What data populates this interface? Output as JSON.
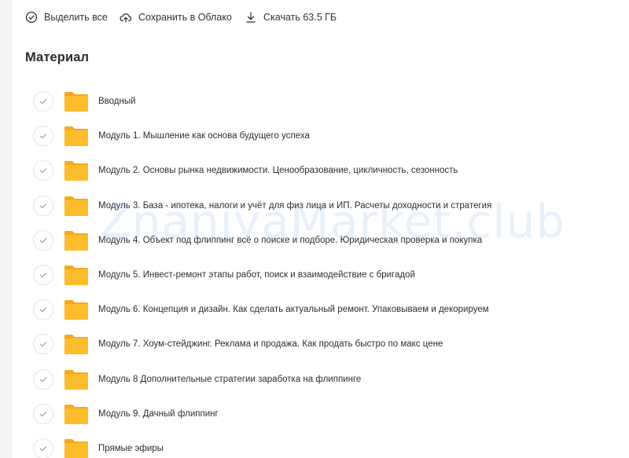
{
  "toolbar": {
    "select_all_label": "Выделить все",
    "save_cloud_label": "Сохранить в Облако",
    "download_label": "Скачать 63.5 ГБ"
  },
  "section": {
    "title": "Материал"
  },
  "items": [
    {
      "label": "Вводный"
    },
    {
      "label": "Модуль 1. Мышление как основа будущего успеха"
    },
    {
      "label": "Модуль 2. Основы рынка недвижимости. Ценообразование, цикличность, сезонность"
    },
    {
      "label": "Модуль 3. База - ипотека, налоги и учёт для физ лица и ИП. Расчеты доходности и стратегия"
    },
    {
      "label": "Модуль 4. Объект под флиппинг всё о поиске и подборе. Юридическая проверка и покупка"
    },
    {
      "label": "Модуль 5. Инвест-ремонт этапы работ, поиск и взаимодействие с бригадой"
    },
    {
      "label": "Модуль 6. Концепция и дизайн. Как сделать актуальный ремонт. Упаковываем и декорируем"
    },
    {
      "label": "Модуль 7. Хоум-стейджинг. Реклама и продажа. Как продать быстро по макс цене"
    },
    {
      "label": "Модуль 8 Дополнительные стратегии заработка на флиппинге"
    },
    {
      "label": "Модуль 9. Дачный флиппинг"
    },
    {
      "label": "Прямые эфиры"
    }
  ],
  "watermark": {
    "text": "ZnaniyaMarket.club"
  },
  "colors": {
    "folder": "#fdbc2c",
    "folder_back": "#f6a81a",
    "check": "#9aa0a6",
    "watermark": "#5a96eb"
  }
}
